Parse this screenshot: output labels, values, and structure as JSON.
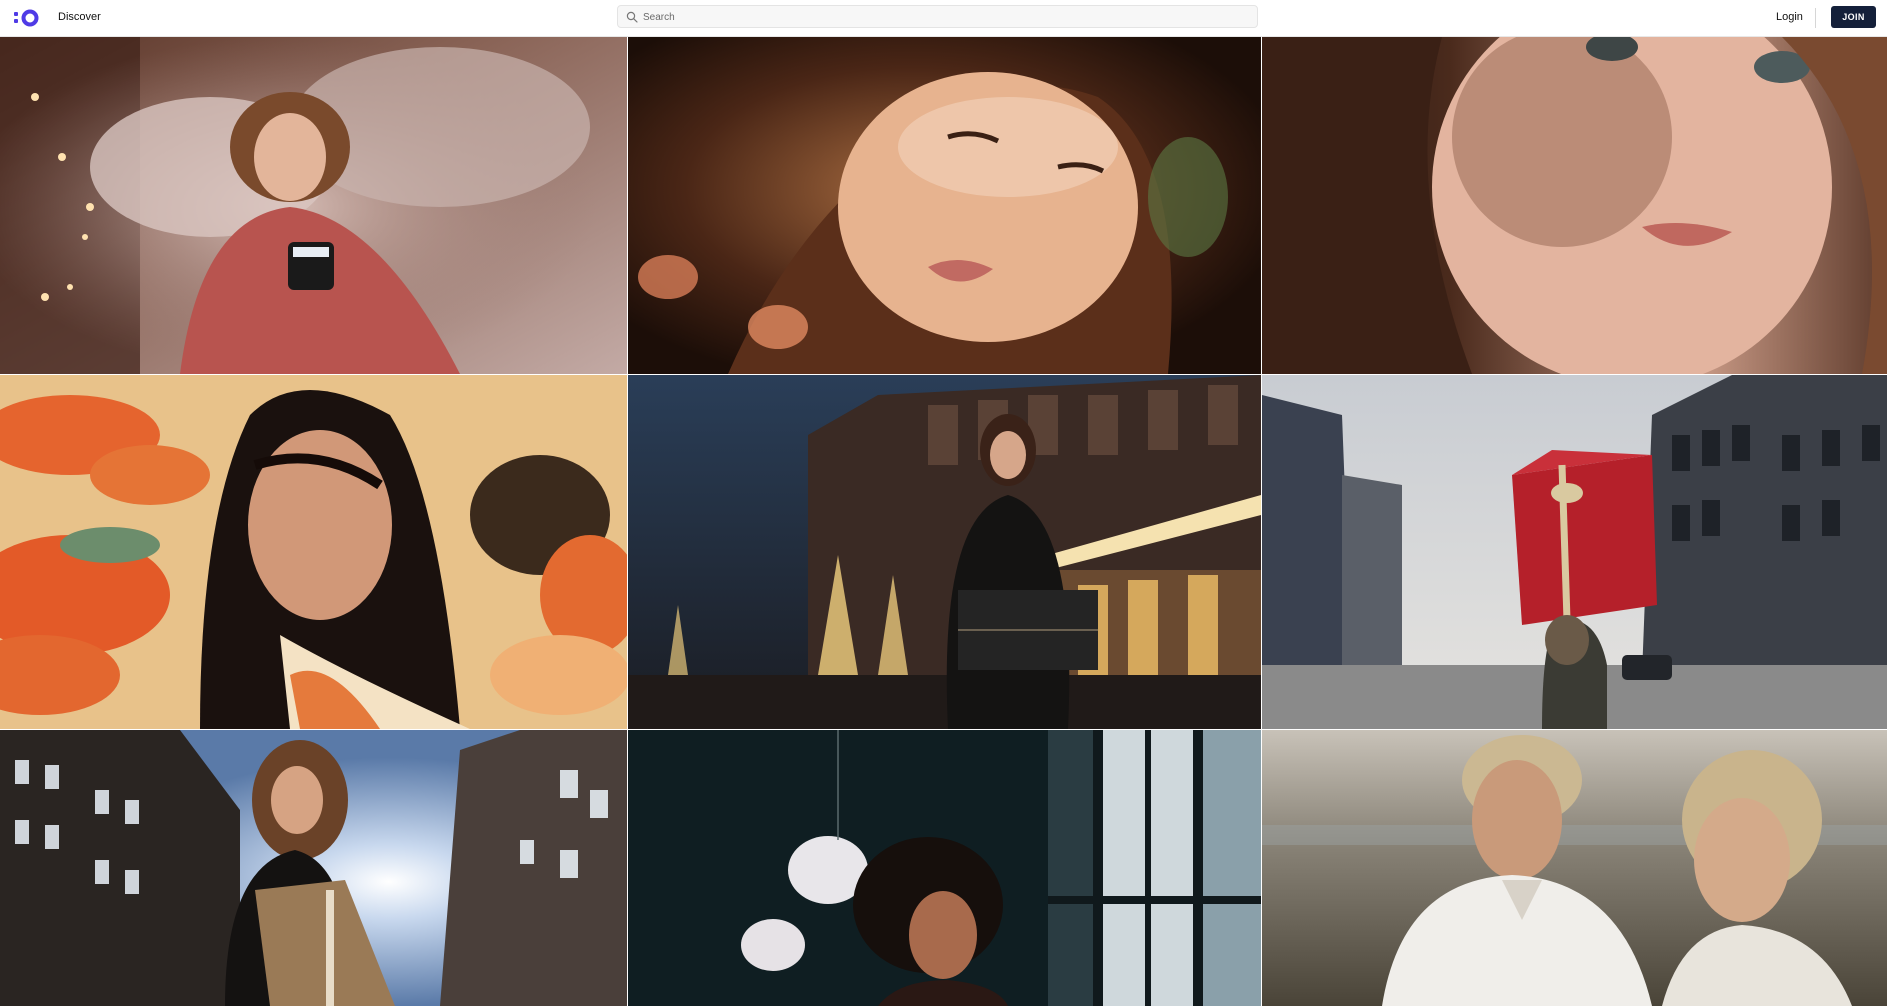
{
  "header": {
    "nav_discover": "Discover",
    "search_placeholder": "Search",
    "login_label": "Login",
    "join_label": "JOIN"
  },
  "icons": {
    "logo": "brand-logo-icon",
    "search": "search-icon"
  },
  "colors": {
    "accent": "#4f3be6",
    "join_bg": "#14203a"
  },
  "gallery": {
    "photos": [
      "woman-in-bed-with-phone",
      "woman-face-warm-light",
      "woman-face-closeup",
      "woman-floral-background",
      "woman-holding-gift-box-street-night",
      "child-holding-red-gift-box",
      "woman-holding-box-low-angle",
      "woman-curly-hair-window",
      "couple-outdoors"
    ]
  }
}
